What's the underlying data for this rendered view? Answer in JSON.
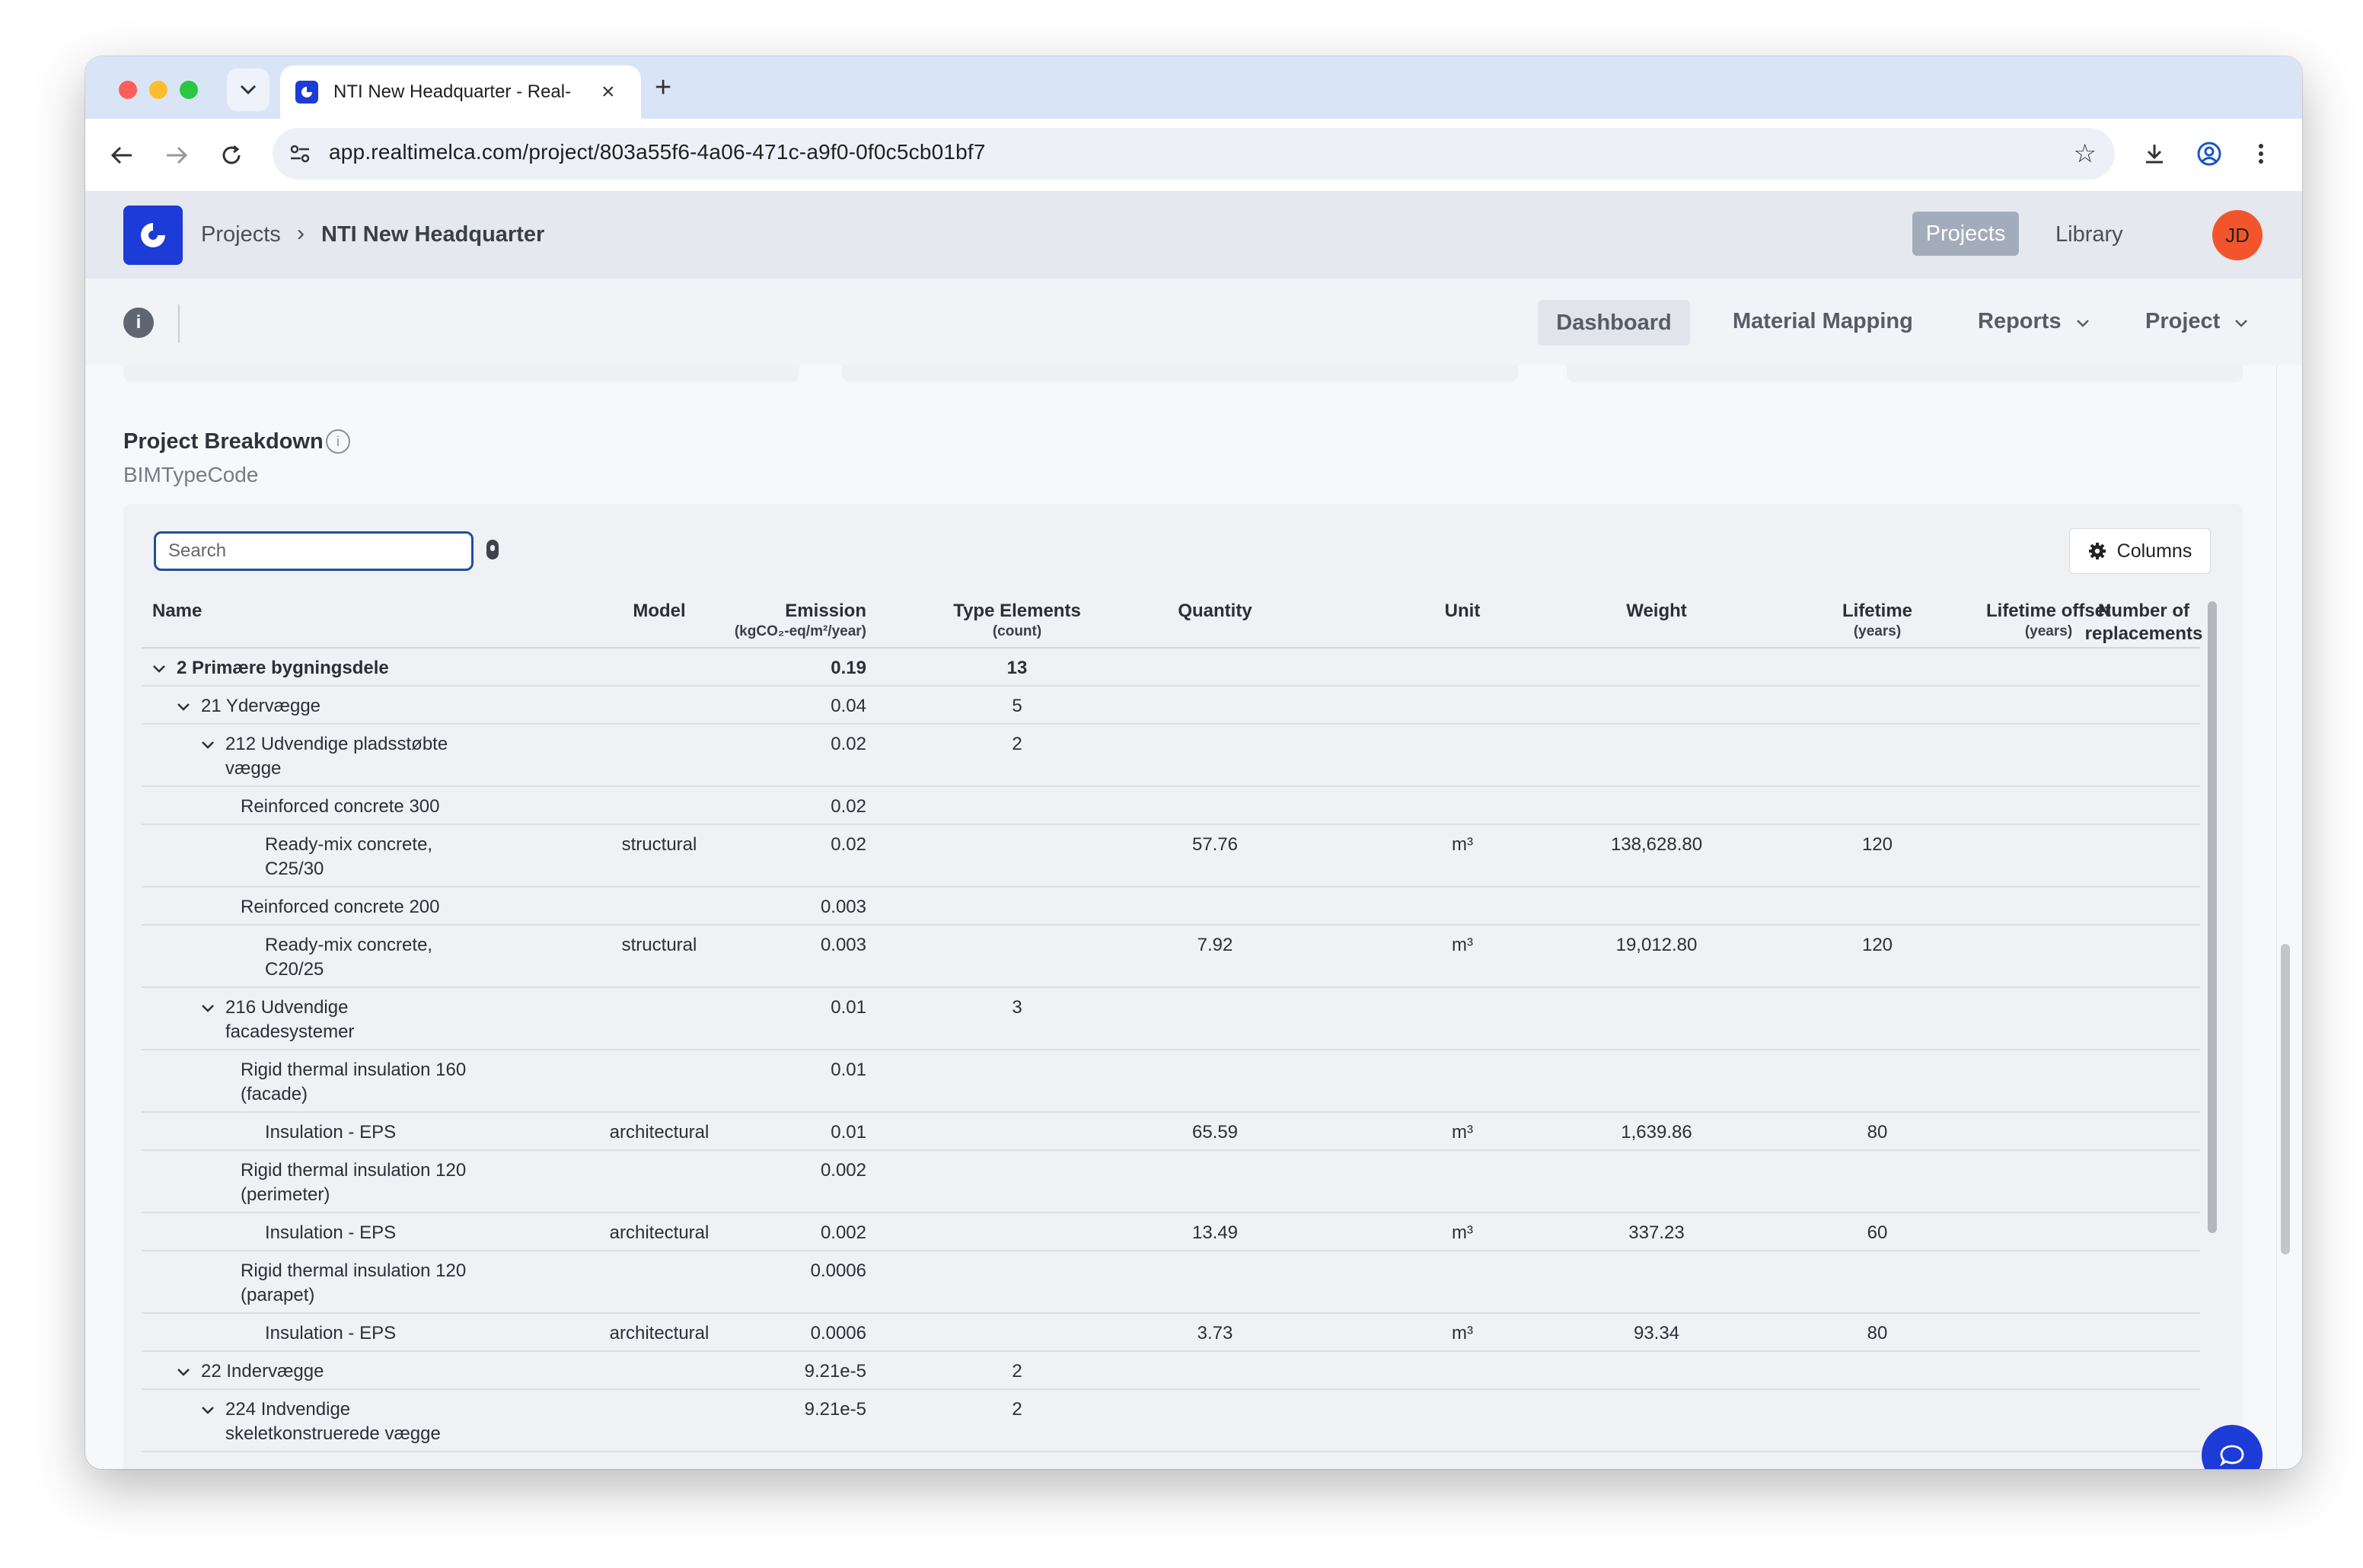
{
  "browser": {
    "tab_title": "NTI New Headquarter - Real-",
    "url": "app.realtimelca.com/project/803a55f6-4a06-471c-a9f0-0f0c5cb01bf7"
  },
  "header": {
    "breadcrumb_projects": "Projects",
    "breadcrumb_current": "NTI New Headquarter",
    "nav_projects": "Projects",
    "nav_library": "Library",
    "avatar_initials": "JD"
  },
  "subnav": {
    "dashboard": "Dashboard",
    "material_mapping": "Material Mapping",
    "reports": "Reports",
    "project": "Project"
  },
  "section": {
    "title": "Project Breakdown",
    "subtitle": "BIMTypeCode"
  },
  "toolbar": {
    "search_placeholder": "Search",
    "columns_label": "Columns"
  },
  "table": {
    "headers": {
      "name": "Name",
      "model": "Model",
      "emission": "Emission",
      "emission_unit": "(kgCO₂-eq/m²/year)",
      "type_elements": "Type Elements",
      "type_elements_unit": "(count)",
      "quantity": "Quantity",
      "unit": "Unit",
      "weight": "Weight",
      "lifetime": "Lifetime",
      "lifetime_unit": "(years)",
      "lifetime_offset": "Lifetime offset",
      "lifetime_offset_unit": "(years)",
      "replacements_line1": "Number of",
      "replacements_line2": "replacements"
    },
    "rows": [
      {
        "name": "2 Primære bygningsdele",
        "name2": "",
        "emission": "0.19",
        "type_elements": "13",
        "model": "",
        "quantity": "",
        "unit": "",
        "weight": "",
        "lifetime": ""
      },
      {
        "name": "21 Ydervægge",
        "name2": "",
        "emission": "0.04",
        "type_elements": "5",
        "model": "",
        "quantity": "",
        "unit": "",
        "weight": "",
        "lifetime": ""
      },
      {
        "name": "212 Udvendige pladsstøbte",
        "name2": "vægge",
        "emission": "0.02",
        "type_elements": "2",
        "model": "",
        "quantity": "",
        "unit": "",
        "weight": "",
        "lifetime": ""
      },
      {
        "name": "Reinforced concrete 300",
        "name2": "",
        "emission": "0.02",
        "type_elements": "",
        "model": "",
        "quantity": "",
        "unit": "",
        "weight": "",
        "lifetime": ""
      },
      {
        "name": "Ready-mix concrete,",
        "name2": "C25/30",
        "emission": "0.02",
        "type_elements": "",
        "model": "structural",
        "quantity": "57.76",
        "unit": "m³",
        "weight": "138,628.80",
        "lifetime": "120"
      },
      {
        "name": "Reinforced concrete 200",
        "name2": "",
        "emission": "0.003",
        "type_elements": "",
        "model": "",
        "quantity": "",
        "unit": "",
        "weight": "",
        "lifetime": ""
      },
      {
        "name": "Ready-mix concrete,",
        "name2": "C20/25",
        "emission": "0.003",
        "type_elements": "",
        "model": "structural",
        "quantity": "7.92",
        "unit": "m³",
        "weight": "19,012.80",
        "lifetime": "120"
      },
      {
        "name": "216 Udvendige",
        "name2": "facadesystemer",
        "emission": "0.01",
        "type_elements": "3",
        "model": "",
        "quantity": "",
        "unit": "",
        "weight": "",
        "lifetime": ""
      },
      {
        "name": "Rigid thermal insulation 160",
        "name2": "(facade)",
        "emission": "0.01",
        "type_elements": "",
        "model": "",
        "quantity": "",
        "unit": "",
        "weight": "",
        "lifetime": ""
      },
      {
        "name": "Insulation - EPS",
        "name2": "",
        "emission": "0.01",
        "type_elements": "",
        "model": "architectural",
        "quantity": "65.59",
        "unit": "m³",
        "weight": "1,639.86",
        "lifetime": "80"
      },
      {
        "name": "Rigid thermal insulation 120",
        "name2": "(perimeter)",
        "emission": "0.002",
        "type_elements": "",
        "model": "",
        "quantity": "",
        "unit": "",
        "weight": "",
        "lifetime": ""
      },
      {
        "name": "Insulation - EPS",
        "name2": "",
        "emission": "0.002",
        "type_elements": "",
        "model": "architectural",
        "quantity": "13.49",
        "unit": "m³",
        "weight": "337.23",
        "lifetime": "60"
      },
      {
        "name": "Rigid thermal insulation 120",
        "name2": "(parapet)",
        "emission": "0.0006",
        "type_elements": "",
        "model": "",
        "quantity": "",
        "unit": "",
        "weight": "",
        "lifetime": ""
      },
      {
        "name": "Insulation - EPS",
        "name2": "",
        "emission": "0.0006",
        "type_elements": "",
        "model": "architectural",
        "quantity": "3.73",
        "unit": "m³",
        "weight": "93.34",
        "lifetime": "80"
      },
      {
        "name": "22 Indervægge",
        "name2": "",
        "emission": "9.21e-5",
        "type_elements": "2",
        "model": "",
        "quantity": "",
        "unit": "",
        "weight": "",
        "lifetime": ""
      },
      {
        "name": "224 Indvendige",
        "name2": "skeletkonstruerede vægge",
        "emission": "9.21e-5",
        "type_elements": "2",
        "model": "",
        "quantity": "",
        "unit": "",
        "weight": "",
        "lifetime": ""
      }
    ]
  },
  "colors": {
    "brand": "#1d3bd6",
    "avatar": "#f2552c",
    "search_border": "#1e4f9e"
  },
  "icons": [
    "search-icon",
    "chevron-right-icon",
    "chevron-down-icon",
    "info-icon",
    "gear-icon",
    "mic-icon",
    "chat-icon",
    "star-icon",
    "download-icon",
    "profile-icon",
    "more-icon",
    "back-icon",
    "forward-icon",
    "reload-icon"
  ]
}
